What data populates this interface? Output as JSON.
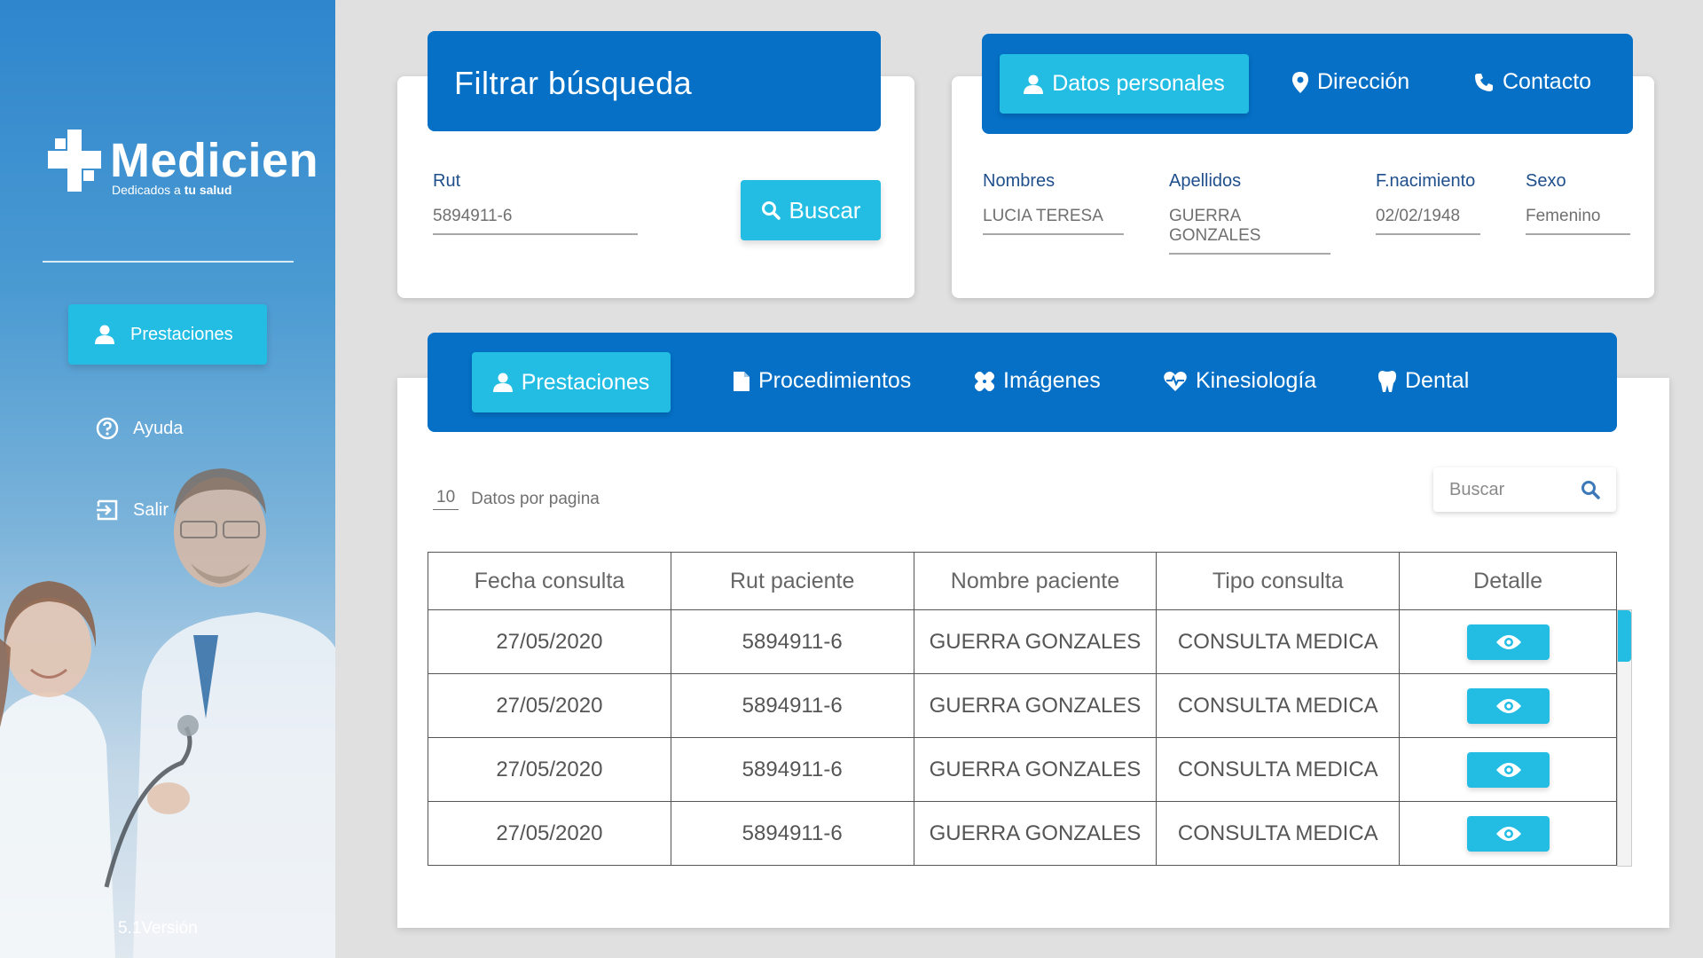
{
  "app": {
    "logo_name": "Medicien",
    "logo_tagline_prefix": "Dedicados a ",
    "logo_tagline_bold": "tu salud",
    "version": "5.1Versión"
  },
  "sidebar": {
    "items": [
      {
        "label": "Prestaciones",
        "icon": "user-icon",
        "active": true
      },
      {
        "label": "Ayuda",
        "icon": "help-circle-icon",
        "active": false
      },
      {
        "label": "Salir",
        "icon": "logout-icon",
        "active": false
      }
    ]
  },
  "filter": {
    "title": "Filtrar búsqueda",
    "rut_label": "Rut",
    "rut_value": "5894911-6",
    "search_button": "Buscar"
  },
  "patient": {
    "tabs": [
      {
        "label": "Datos personales",
        "icon": "user-icon",
        "active": true
      },
      {
        "label": "Dirección",
        "icon": "map-pin-icon",
        "active": false
      },
      {
        "label": "Contacto",
        "icon": "phone-icon",
        "active": false
      }
    ],
    "fields": [
      {
        "label": "Nombres",
        "value": "LUCIA TERESA"
      },
      {
        "label": "Apellidos",
        "value": "GUERRA GONZALES"
      },
      {
        "label": "F.nacimiento",
        "value": "02/02/1948"
      },
      {
        "label": "Sexo",
        "value": "Femenino"
      }
    ]
  },
  "records": {
    "tabs": [
      {
        "label": "Prestaciones",
        "icon": "user-icon",
        "active": true
      },
      {
        "label": "Procedimientos",
        "icon": "document-icon",
        "active": false
      },
      {
        "label": "Imágenes",
        "icon": "bandage-icon",
        "active": false
      },
      {
        "label": "Kinesiología",
        "icon": "heartbeat-icon",
        "active": false
      },
      {
        "label": "Dental",
        "icon": "tooth-icon",
        "active": false
      }
    ],
    "per_page_value": "10",
    "per_page_label": "Datos por pagina",
    "search_placeholder": "Buscar",
    "columns": [
      "Fecha consulta",
      "Rut paciente",
      "Nombre paciente",
      "Tipo consulta",
      "Detalle"
    ],
    "rows": [
      {
        "fecha": "27/05/2020",
        "rut": "5894911-6",
        "nombre": "GUERRA GONZALES",
        "tipo": "CONSULTA MEDICA"
      },
      {
        "fecha": "27/05/2020",
        "rut": "5894911-6",
        "nombre": "GUERRA GONZALES",
        "tipo": "CONSULTA MEDICA"
      },
      {
        "fecha": "27/05/2020",
        "rut": "5894911-6",
        "nombre": "GUERRA GONZALES",
        "tipo": "CONSULTA MEDICA"
      },
      {
        "fecha": "27/05/2020",
        "rut": "5894911-6",
        "nombre": "GUERRA GONZALES",
        "tipo": "CONSULTA MEDICA"
      }
    ]
  },
  "colors": {
    "primary": "#0570c6",
    "accent": "#23bde4",
    "label": "#1f4f8c"
  }
}
